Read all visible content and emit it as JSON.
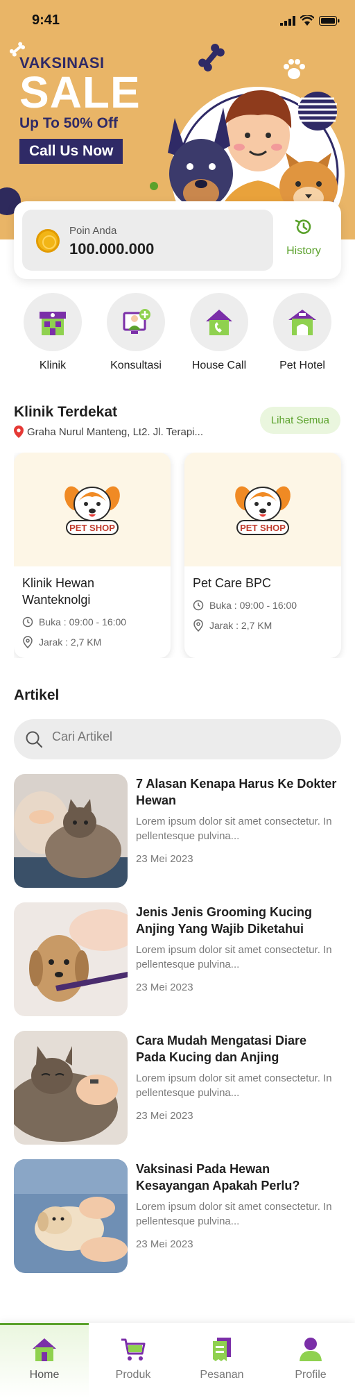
{
  "status": {
    "time": "9:41"
  },
  "hero": {
    "label": "VAKSINASI",
    "headline": "SALE",
    "subline": "Up To 50% Off",
    "cta": "Call Us Now"
  },
  "points": {
    "label": "Poin Anda",
    "value": "100.000.000",
    "history_label": "History"
  },
  "categories": [
    {
      "label": "Klinik",
      "icon": "clinic-icon"
    },
    {
      "label": "Konsultasi",
      "icon": "consultation-icon"
    },
    {
      "label": "House Call",
      "icon": "house-call-icon"
    },
    {
      "label": "Pet Hotel",
      "icon": "pet-hotel-icon"
    }
  ],
  "nearby": {
    "title": "Klinik Terdekat",
    "location": "Graha Nurul Manteng, Lt2. Jl. Terapi...",
    "see_all": "Lihat Semua",
    "clinics": [
      {
        "name": "Klinik Hewan Wanteknolgi",
        "hours": "Buka : 09:00 - 16:00",
        "distance": "Jarak : 2,7 KM",
        "logo_text": "PET SHOP"
      },
      {
        "name": "Pet Care BPC",
        "hours": "Buka : 09:00 - 16:00",
        "distance": "Jarak : 2,7 KM",
        "logo_text": "PET SHOP"
      }
    ]
  },
  "articles": {
    "title": "Artikel",
    "search_placeholder": "Cari Artikel",
    "items": [
      {
        "title": "7 Alasan Kenapa Harus Ke Dokter Hewan",
        "desc": "Lorem ipsum dolor sit amet consectetur. In pellentesque pulvina...",
        "date": "23 Mei 2023"
      },
      {
        "title": "Jenis Jenis Grooming Kucing Anjing Yang Wajib Diketahui",
        "desc": "Lorem ipsum dolor sit amet consectetur. In pellentesque pulvina...",
        "date": "23 Mei 2023"
      },
      {
        "title": "Cara Mudah Mengatasi Diare Pada Kucing dan Anjing",
        "desc": "Lorem ipsum dolor sit amet consectetur. In pellentesque pulvina...",
        "date": "23 Mei 2023"
      },
      {
        "title": "Vaksinasi Pada Hewan Kesayangan Apakah Perlu?",
        "desc": "Lorem ipsum dolor sit amet consectetur. In pellentesque pulvina...",
        "date": "23 Mei 2023"
      }
    ]
  },
  "nav": [
    {
      "label": "Home",
      "icon": "home-icon",
      "active": true
    },
    {
      "label": "Produk",
      "icon": "cart-icon",
      "active": false
    },
    {
      "label": "Pesanan",
      "icon": "receipt-icon",
      "active": false
    },
    {
      "label": "Profile",
      "icon": "user-icon",
      "active": false
    }
  ],
  "colors": {
    "accent": "#5aa12b",
    "purple": "#7b2fa8",
    "hero_bg": "#e9b567",
    "navy": "#2f2a66"
  }
}
